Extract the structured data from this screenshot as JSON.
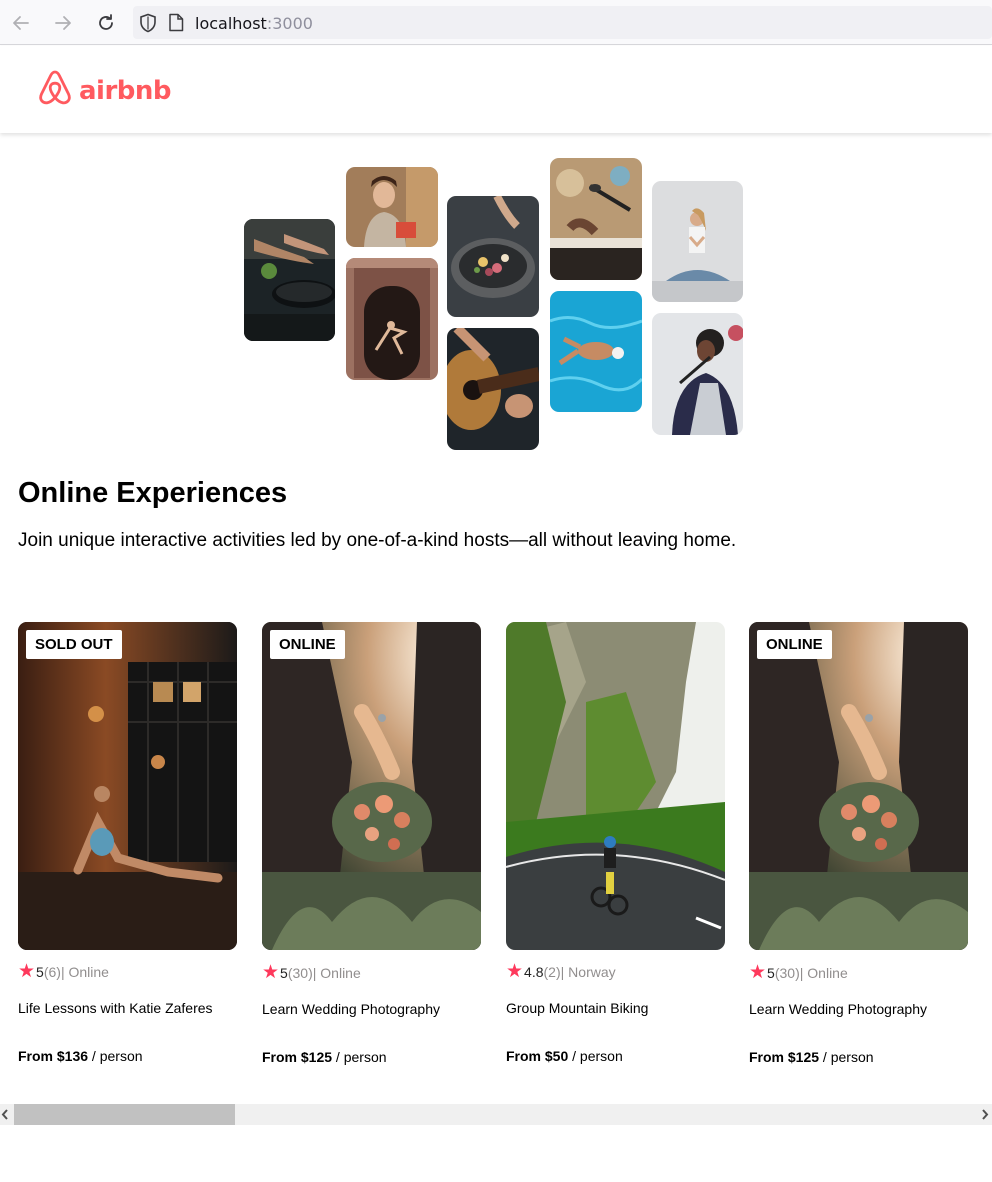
{
  "browser": {
    "url_host": "localhost",
    "url_port": ":3000"
  },
  "header": {
    "logo_text": "airbnb",
    "logo_icon": "airbnb-belo-icon",
    "brand_color": "#ff5a5f"
  },
  "hero": {
    "photos": [
      {
        "name": "hero-photo-cooking",
        "subject": "cooking"
      },
      {
        "name": "hero-photo-woman-smiling",
        "subject": "host portrait"
      },
      {
        "name": "hero-photo-dancer",
        "subject": "dancer in doorway"
      },
      {
        "name": "hero-photo-food-bowl",
        "subject": "food bowl"
      },
      {
        "name": "hero-photo-guitar",
        "subject": "guitar"
      },
      {
        "name": "hero-photo-piano-mic",
        "subject": "piano and microphone"
      },
      {
        "name": "hero-photo-swimmer",
        "subject": "swimmer"
      },
      {
        "name": "hero-photo-yoga",
        "subject": "yoga"
      },
      {
        "name": "hero-photo-singer",
        "subject": "singer"
      }
    ]
  },
  "main": {
    "title": "Online Experiences",
    "subtitle": "Join unique interactive activities led by one-of-a-kind hosts—all without leaving home."
  },
  "cards": [
    {
      "badge": "SOLD OUT",
      "rating": "5",
      "count": "(6)",
      "location": " | Online",
      "title": "Life Lessons with Katie Zaferes",
      "price": "From $136",
      "unit": " / person"
    },
    {
      "badge": "ONLINE",
      "rating": "5",
      "count": "(30)",
      "location": " | Online",
      "title": "Learn Wedding Photography",
      "price": "From $125",
      "unit": " / person"
    },
    {
      "badge": "",
      "rating": "4.8",
      "count": "(2)",
      "location": " | Norway",
      "title": "Group Mountain Biking",
      "price": "From $50",
      "unit": " / person"
    },
    {
      "badge": "ONLINE",
      "rating": "5",
      "count": "(30)",
      "location": " | Online",
      "title": "Learn Wedding Photography",
      "price": "From $125",
      "unit": " / person"
    }
  ],
  "colors": {
    "star": "#fe395c",
    "muted_text": "#918e8e"
  }
}
